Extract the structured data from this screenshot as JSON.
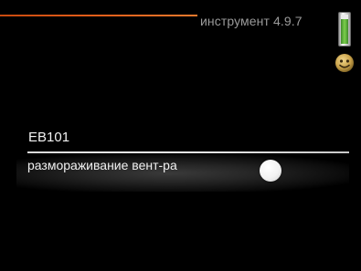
{
  "header": {
    "menu_title": "инструмент 4.9.7",
    "thermometer_icon": "thermometer-icon",
    "status_icon": "smiley-face-icon",
    "accent_color": "#e8611c"
  },
  "main": {
    "section_label": "EB101",
    "setting": {
      "label": "размораживание вент-ра",
      "toggle_state": "off"
    }
  }
}
